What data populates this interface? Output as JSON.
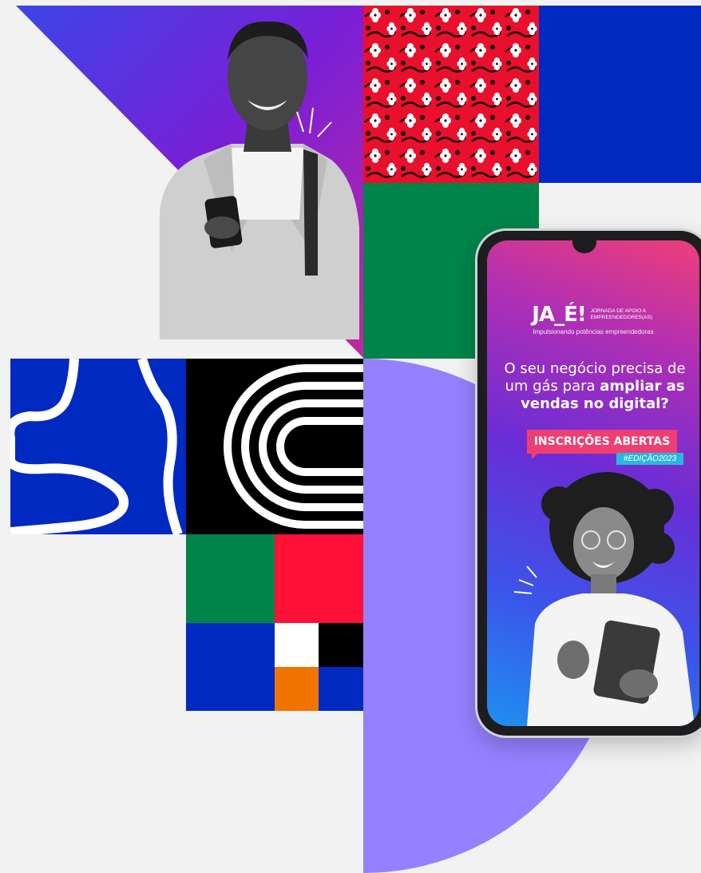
{
  "phone_screen": {
    "logo_text": "JA_É!",
    "logo_subtitle": "JORNADA DE APOIO A EMPREENDEDORES(AS)",
    "tagline": "Impulsionando potências empreendedoras",
    "headline_plain_1": "O seu negócio precisa de",
    "headline_plain_2": "um gás para ",
    "headline_bold_1": "ampliar as",
    "headline_bold_2": "vendas no digital?",
    "badge": "INSCRIÇÕES ABERTAS",
    "edition": "#EDIÇÃO2023"
  },
  "colors": {
    "background": "#f2f2f2",
    "royal_blue": "#0029c2",
    "green": "#00844a",
    "red": "#ff1036",
    "orange": "#f27400",
    "lavender": "#9580ff",
    "purple": "#6a2dd6",
    "pink": "#ef3e78",
    "black": "#000000",
    "white": "#ffffff"
  }
}
